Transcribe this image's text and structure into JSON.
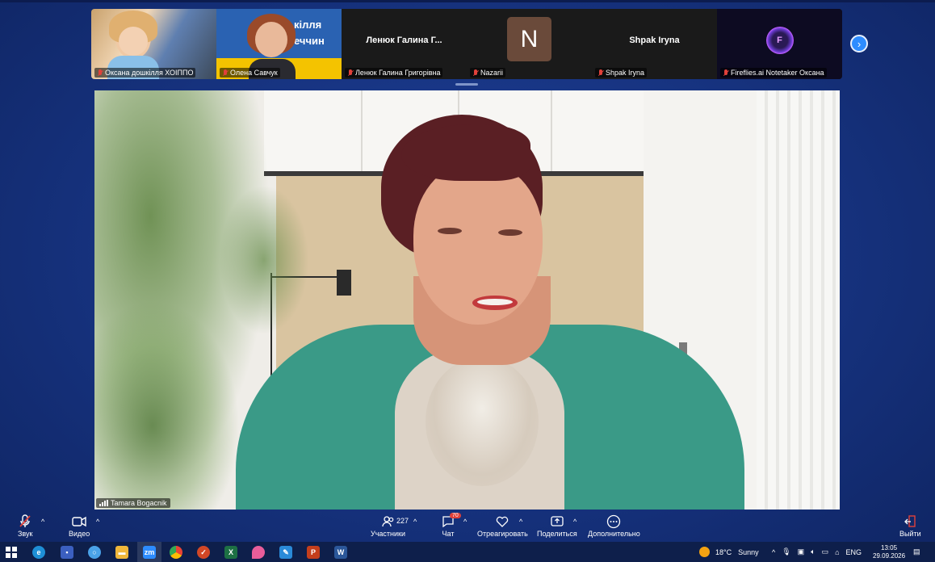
{
  "participants_strip": {
    "tiles": [
      {
        "name": "Оксана дошкілля ХОІППО",
        "type": "video"
      },
      {
        "name": "Олена Савчук",
        "type": "video",
        "banner_text": "кілля\nеччин"
      },
      {
        "name": "Ленюк Галина Григорівна",
        "display_name": "Ленюк Галина Г...",
        "type": "name"
      },
      {
        "name": "Nazarii",
        "avatar_letter": "N",
        "type": "avatar"
      },
      {
        "name": "Shpak Iryna",
        "display_name": "Shpak Iryna",
        "type": "name"
      },
      {
        "name": "Fireflies.ai Notetaker Оксана",
        "type": "logo"
      }
    ],
    "next_icon": "chevron-right-icon"
  },
  "main_speaker": {
    "name": "Tamara Bogacnik"
  },
  "toolbar": {
    "audio_label": "Звук",
    "video_label": "Видео",
    "participants_label": "Участники",
    "participants_count": "227",
    "chat_label": "Чат",
    "chat_badge": "70",
    "react_label": "Отреагировать",
    "share_label": "Поделиться",
    "more_label": "Дополнительно",
    "leave_label": "Выйти"
  },
  "taskbar": {
    "weather_temp": "18°C",
    "weather_desc": "Sunny",
    "language": "ENG",
    "time": "13:05",
    "date": "29.09.2026",
    "zoom_label": "zm"
  },
  "colors": {
    "background": "#16327e",
    "accent_blue": "#2d8cff",
    "muted_red": "#e0413a",
    "taskbar": "#0e1f4b"
  }
}
